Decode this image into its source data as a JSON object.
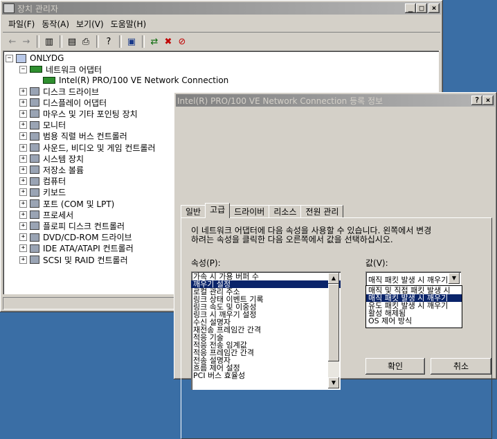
{
  "devmgr": {
    "title": "장치 관리자",
    "menus": [
      "파일(F)",
      "동작(A)",
      "보기(V)",
      "도움말(H)"
    ],
    "toolbar_icons": [
      "back-icon",
      "forward-icon",
      "show-hide-tree-icon",
      "properties-icon",
      "print-icon",
      "help-icon",
      "scan-hardware-icon",
      "update-driver-icon",
      "disable-icon",
      "uninstall-icon"
    ],
    "tree": {
      "root": "ONLYDG",
      "network": "네트워크 어댑터",
      "nic": "Intel(R) PRO/100 VE Network Connection",
      "categories": [
        {
          "label": "디스크 드라이브",
          "icon": "disk-drive-icon"
        },
        {
          "label": "디스플레이 어댑터",
          "icon": "display-adapter-icon"
        },
        {
          "label": "마우스 및 기타 포인팅 장치",
          "icon": "mouse-icon"
        },
        {
          "label": "모니터",
          "icon": "monitor-icon"
        },
        {
          "label": "범용 직렬 버스 컨트롤러",
          "icon": "usb-icon"
        },
        {
          "label": "사운드, 비디오 및 게임 컨트롤러",
          "icon": "sound-icon"
        },
        {
          "label": "시스템 장치",
          "icon": "system-device-icon"
        },
        {
          "label": "저장소 볼륨",
          "icon": "storage-volume-icon"
        },
        {
          "label": "컴퓨터",
          "icon": "computer-icon"
        },
        {
          "label": "키보드",
          "icon": "keyboard-icon"
        },
        {
          "label": "포트 (COM 및 LPT)",
          "icon": "port-icon"
        },
        {
          "label": "프로세서",
          "icon": "processor-icon"
        },
        {
          "label": "플로피 디스크 컨트롤러",
          "icon": "floppy-controller-icon"
        },
        {
          "label": "DVD/CD-ROM 드라이브",
          "icon": "dvd-drive-icon"
        },
        {
          "label": "IDE ATA/ATAPI 컨트롤러",
          "icon": "ide-controller-icon"
        },
        {
          "label": "SCSI 및 RAID 컨트롤러",
          "icon": "scsi-controller-icon"
        }
      ]
    }
  },
  "dialog": {
    "title": "Intel(R) PRO/100 VE Network Connection 등록 정보",
    "help_btn": "?",
    "close_btn": "×",
    "tabs": [
      "일반",
      "고급",
      "드라이버",
      "리소스",
      "전원 관리"
    ],
    "description_line1": "이 네트워크 어댑터에 다음 속성을 사용할 수 있습니다. 왼쪽에서 변경",
    "description_line2": "하려는 속성을 클릭한 다음 오른쪽에서 값을 선택하십시오.",
    "property_label": "속성(P):",
    "value_label": "값(V):",
    "properties": [
      "가속 시 가용 버퍼 수",
      "깨우기 설정",
      "로컬 관리 주소",
      "링크 상태 이벤트 기록",
      "링크 속도 및 이중성",
      "링크 시 깨우기 설정",
      "수신 설명자",
      "재전송 프레임간 간격",
      "적응 기술",
      "적응 전송 임계값",
      "적응 프레임간 간격",
      "전송 설명자",
      "흐름 제어 설정",
      "PCI 버스 효율성"
    ],
    "selected_property_index": 1,
    "value_selected": "매직 패킷 발생 시 깨우기",
    "value_options": [
      "매직 및 직접 패킷 발생 시",
      "매직 패킷 발생 시 깨우기",
      "유도 패킷 발생 시 깨우기",
      "활성 해제됨",
      "OS 제어 방식"
    ],
    "selected_value_index": 1,
    "ok_btn": "확인",
    "cancel_btn": "취소"
  },
  "colors": {
    "desktop": "#3a6ea5",
    "face": "#d4d0c8",
    "selection": "#0a246a"
  }
}
